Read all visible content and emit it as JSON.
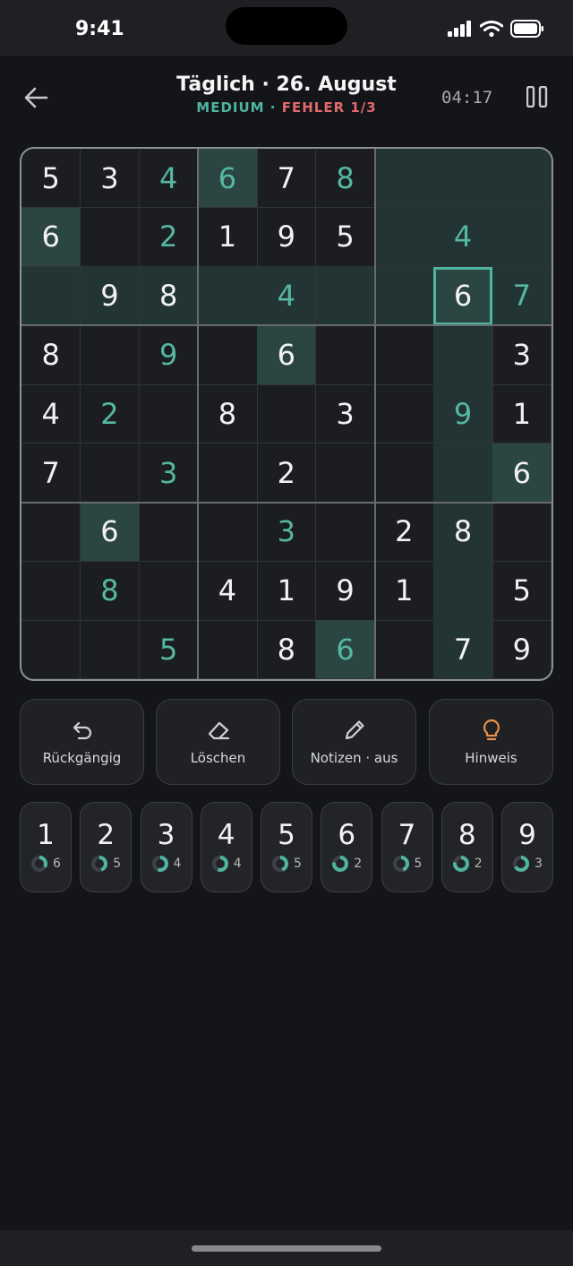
{
  "status_bar": {
    "time": "9:41"
  },
  "header": {
    "title": "Täglich · 26. August",
    "difficulty": "MEDIUM",
    "separator": " · ",
    "errors": "FEHLER 1/3",
    "timer": "04:17"
  },
  "colors": {
    "accent": "#4fb5a1",
    "error": "#e0696b",
    "hint_bulb": "#e8904c",
    "background": "#141519"
  },
  "board": {
    "selected": {
      "row": 2,
      "col": 7
    },
    "cells": [
      [
        {
          "v": "5",
          "k": "given"
        },
        {
          "v": "3",
          "k": "given"
        },
        {
          "v": "4",
          "k": "user"
        },
        {
          "v": "6",
          "k": "user"
        },
        {
          "v": "7",
          "k": "given"
        },
        {
          "v": "8",
          "k": "user"
        },
        {
          "v": "",
          "k": "empty"
        },
        {
          "v": "",
          "k": "empty"
        },
        {
          "v": "",
          "k": "empty"
        }
      ],
      [
        {
          "v": "6",
          "k": "given"
        },
        {
          "v": "",
          "k": "empty"
        },
        {
          "v": "2",
          "k": "user"
        },
        {
          "v": "1",
          "k": "given"
        },
        {
          "v": "9",
          "k": "given"
        },
        {
          "v": "5",
          "k": "given"
        },
        {
          "v": "",
          "k": "empty"
        },
        {
          "v": "4",
          "k": "user"
        },
        {
          "v": "",
          "k": "empty"
        }
      ],
      [
        {
          "v": "",
          "k": "empty"
        },
        {
          "v": "9",
          "k": "given"
        },
        {
          "v": "8",
          "k": "given"
        },
        {
          "v": "",
          "k": "empty"
        },
        {
          "v": "4",
          "k": "user"
        },
        {
          "v": "",
          "k": "empty"
        },
        {
          "v": "",
          "k": "empty"
        },
        {
          "v": "6",
          "k": "given"
        },
        {
          "v": "7",
          "k": "user"
        }
      ],
      [
        {
          "v": "8",
          "k": "given"
        },
        {
          "v": "",
          "k": "empty"
        },
        {
          "v": "9",
          "k": "user"
        },
        {
          "v": "",
          "k": "empty"
        },
        {
          "v": "6",
          "k": "given"
        },
        {
          "v": "",
          "k": "empty"
        },
        {
          "v": "",
          "k": "empty"
        },
        {
          "v": "",
          "k": "empty"
        },
        {
          "v": "3",
          "k": "given"
        }
      ],
      [
        {
          "v": "4",
          "k": "given"
        },
        {
          "v": "2",
          "k": "user"
        },
        {
          "v": "",
          "k": "empty"
        },
        {
          "v": "8",
          "k": "given"
        },
        {
          "v": "",
          "k": "empty"
        },
        {
          "v": "3",
          "k": "given"
        },
        {
          "v": "",
          "k": "empty"
        },
        {
          "v": "9",
          "k": "user"
        },
        {
          "v": "1",
          "k": "given"
        }
      ],
      [
        {
          "v": "7",
          "k": "given"
        },
        {
          "v": "",
          "k": "empty"
        },
        {
          "v": "3",
          "k": "user"
        },
        {
          "v": "",
          "k": "empty"
        },
        {
          "v": "2",
          "k": "given"
        },
        {
          "v": "",
          "k": "empty"
        },
        {
          "v": "",
          "k": "empty"
        },
        {
          "v": "",
          "k": "empty"
        },
        {
          "v": "6",
          "k": "given"
        }
      ],
      [
        {
          "v": "",
          "k": "empty"
        },
        {
          "v": "6",
          "k": "given"
        },
        {
          "v": "",
          "k": "empty"
        },
        {
          "v": "",
          "k": "empty"
        },
        {
          "v": "3",
          "k": "user"
        },
        {
          "v": "",
          "k": "empty"
        },
        {
          "v": "2",
          "k": "given"
        },
        {
          "v": "8",
          "k": "given"
        },
        {
          "v": "",
          "k": "empty"
        }
      ],
      [
        {
          "v": "",
          "k": "empty"
        },
        {
          "v": "8",
          "k": "user"
        },
        {
          "v": "",
          "k": "empty"
        },
        {
          "v": "4",
          "k": "given"
        },
        {
          "v": "1",
          "k": "given"
        },
        {
          "v": "9",
          "k": "given"
        },
        {
          "v": "1",
          "k": "error"
        },
        {
          "v": "",
          "k": "empty"
        },
        {
          "v": "5",
          "k": "given"
        }
      ],
      [
        {
          "v": "",
          "k": "empty"
        },
        {
          "v": "",
          "k": "empty"
        },
        {
          "v": "5",
          "k": "user"
        },
        {
          "v": "",
          "k": "empty"
        },
        {
          "v": "8",
          "k": "given"
        },
        {
          "v": "6",
          "k": "user"
        },
        {
          "v": "",
          "k": "empty"
        },
        {
          "v": "7",
          "k": "given"
        },
        {
          "v": "9",
          "k": "given"
        }
      ]
    ]
  },
  "tools": [
    {
      "label": "Rückgängig",
      "icon": "undo-icon"
    },
    {
      "label": "Löschen",
      "icon": "eraser-icon"
    },
    {
      "label": "Notizen · aus",
      "icon": "pencil-icon"
    },
    {
      "label": "Hinweis",
      "icon": "lightbulb-icon"
    }
  ],
  "numpad": [
    {
      "digit": "1",
      "remaining": "6"
    },
    {
      "digit": "2",
      "remaining": "5"
    },
    {
      "digit": "3",
      "remaining": "4"
    },
    {
      "digit": "4",
      "remaining": "4"
    },
    {
      "digit": "5",
      "remaining": "5"
    },
    {
      "digit": "6",
      "remaining": "2"
    },
    {
      "digit": "7",
      "remaining": "5"
    },
    {
      "digit": "8",
      "remaining": "2"
    },
    {
      "digit": "9",
      "remaining": "3"
    }
  ]
}
